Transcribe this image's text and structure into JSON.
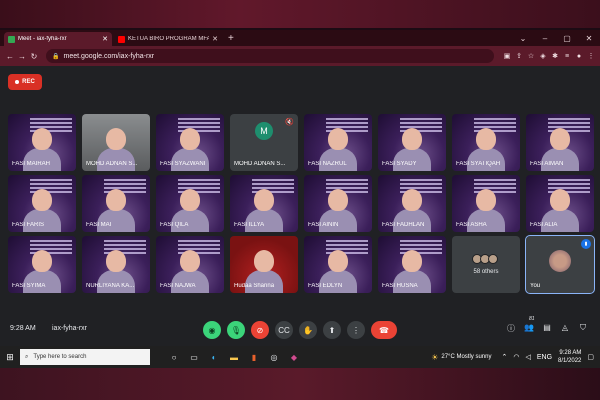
{
  "browser": {
    "tabs": [
      {
        "label": "Meet - iax-fyha-rxr",
        "favicon_color": "#34a853",
        "active": true
      },
      {
        "label": "KETUA BIRO PROGRAM MFA 2022",
        "favicon_color": "#ff0000",
        "active": false
      }
    ],
    "new_tab": "+",
    "address": "meet.google.com/iax-fyha-rxr"
  },
  "meet": {
    "rec_label": "REC",
    "participants": [
      {
        "name": "FASI MAIRAH",
        "style": "purple"
      },
      {
        "name": "MOHD ADNAN S...",
        "style": "room"
      },
      {
        "name": "FASI SYAZWANI",
        "style": "purple"
      },
      {
        "name": "MOHD ADNAN S...",
        "style": "dark",
        "avatar_letter": "M",
        "muted": true
      },
      {
        "name": "FASI NAZRUL",
        "style": "purple"
      },
      {
        "name": "FASI SYADY",
        "style": "purple"
      },
      {
        "name": "FASI SYATIQAH",
        "style": "purple"
      },
      {
        "name": "FASI AIMAN",
        "style": "purple"
      },
      {
        "name": "FASI FARIS",
        "style": "purple"
      },
      {
        "name": "FASI MAI",
        "style": "purple"
      },
      {
        "name": "FASI QILA",
        "style": "purple"
      },
      {
        "name": "FASI ILLYA",
        "style": "purple"
      },
      {
        "name": "FASI AININ",
        "style": "purple"
      },
      {
        "name": "FASI FADHLAN",
        "style": "purple"
      },
      {
        "name": "FASI ASHA",
        "style": "purple"
      },
      {
        "name": "FASI ALIA",
        "style": "purple"
      },
      {
        "name": "FASI SYIMA",
        "style": "purple"
      },
      {
        "name": "NURLIYANA KA...",
        "style": "purple"
      },
      {
        "name": "FASI NAJWA",
        "style": "purple"
      },
      {
        "name": "Hudaa Sharina",
        "style": "red"
      },
      {
        "name": "FASI EDLYN",
        "style": "purple"
      },
      {
        "name": "FASI HUSNA",
        "style": "purple"
      }
    ],
    "others_label": "58 others",
    "you_label": "You",
    "meeting_time": "9:28 AM",
    "meeting_code": "iax-fyha-rxr",
    "participant_count": "81"
  },
  "taskbar": {
    "search_placeholder": "Type here to search",
    "weather": "27°C  Mostly sunny",
    "lang": "ENG",
    "time": "9:28 AM",
    "date": "8/1/2022"
  },
  "icons": {
    "mic": "mic-icon",
    "camera_off": "camera-off-icon",
    "captions": "captions-icon",
    "raise_hand": "raise-hand-icon",
    "present": "present-icon",
    "more": "more-options-icon",
    "end_call": "end-call-icon"
  }
}
